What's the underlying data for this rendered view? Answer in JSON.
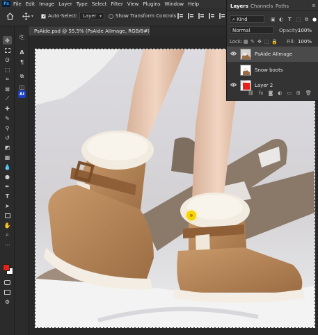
{
  "menubar": {
    "logo": "Ps",
    "items": [
      "File",
      "Edit",
      "Image",
      "Layer",
      "Type",
      "Select",
      "Filter",
      "View",
      "Plugins",
      "Window",
      "Help"
    ]
  },
  "options": {
    "auto_select_label": "Auto-Select:",
    "auto_select_checked": true,
    "target_value": "Layer",
    "transform_label": "Show Transform Controls",
    "transform_checked": false
  },
  "document": {
    "tab_title": "PsAide.psd @ 55.5% (PsAide AIImage, RGB/8#) *",
    "close": "×"
  },
  "layers_panel": {
    "tabs": [
      "Layers",
      "Channels",
      "Paths"
    ],
    "active_tab": "Layers",
    "kind_label": "Kind",
    "blend_mode": "Normal",
    "opacity_label": "Opacity:",
    "opacity_value": "100%",
    "lock_label": "Lock:",
    "fill_label": "Fill:",
    "fill_value": "100%",
    "layers": [
      {
        "name": "PsAide AIImage",
        "selected": true,
        "visible": true
      },
      {
        "name": "Snow boots",
        "selected": false,
        "visible": false
      },
      {
        "name": "Layer 2",
        "selected": false,
        "visible": true
      }
    ]
  },
  "colors": {
    "foreground": "#e8201a",
    "background": "#ffffff",
    "accent": "#31a8ff"
  }
}
